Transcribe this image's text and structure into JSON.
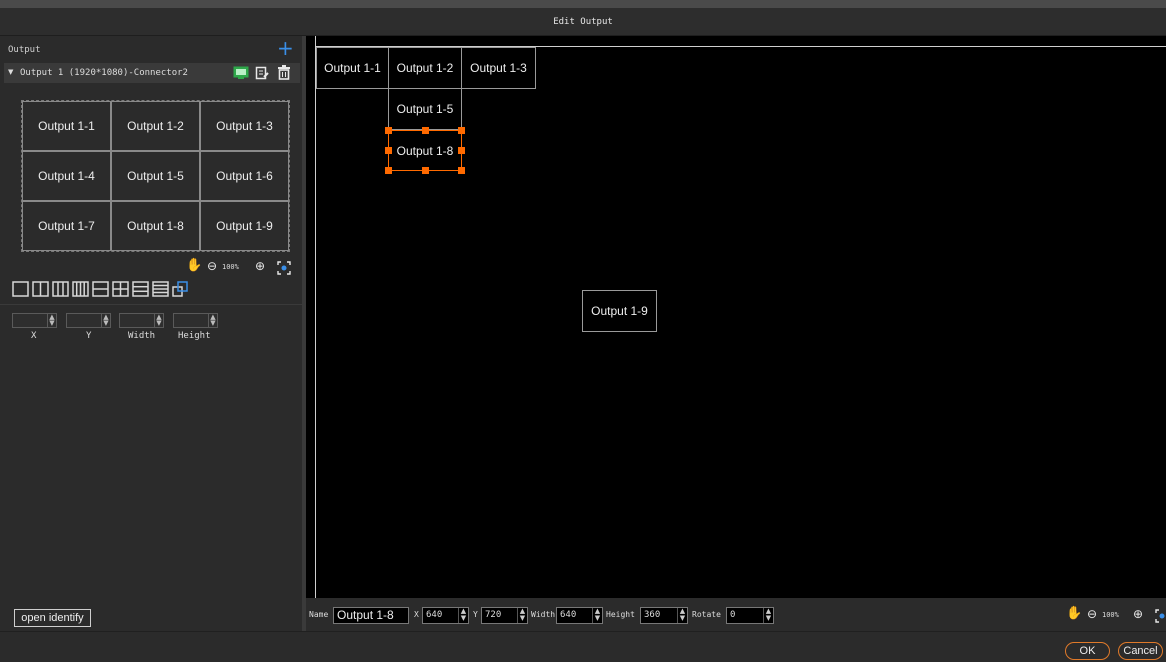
{
  "window": {
    "title": "Edit Output"
  },
  "left_panel": {
    "section_label": "Output",
    "output_row": {
      "label": "Output 1 (1920*1080)-Connector2"
    },
    "preview_cells": [
      "Output 1-1",
      "Output 1-2",
      "Output 1-3",
      "Output 1-4",
      "Output 1-5",
      "Output 1-6",
      "Output 1-7",
      "Output 1-8",
      "Output 1-9"
    ],
    "zoom": "100%",
    "fields": {
      "x_label": "X",
      "y_label": "Y",
      "width_label": "Width",
      "height_label": "Height"
    },
    "open_identify": "open identify"
  },
  "canvas": {
    "cells": {
      "c11": "Output 1-1",
      "c12": "Output 1-2",
      "c13": "Output 1-3",
      "c15": "Output 1-5",
      "c18": "Output 1-8",
      "c19": "Output 1-9"
    },
    "zoom": "100%"
  },
  "props": {
    "name_label": "Name",
    "name_value": "Output 1-8",
    "x_label": "X",
    "x_value": "640",
    "y_label": "Y",
    "y_value": "720",
    "width_label": "Width",
    "width_value": "640",
    "height_label": "Height",
    "height_value": "360",
    "rotate_label": "Rotate",
    "rotate_value": "0"
  },
  "footer": {
    "ok": "OK",
    "cancel": "Cancel"
  },
  "colors": {
    "accent": "#ff6a00",
    "plus": "#3a8fe8",
    "monitor": "#2ea84a"
  },
  "icons": [
    "plus-icon",
    "monitor-icon",
    "edit-icon",
    "trash-icon",
    "hand-icon",
    "zoom-out-icon",
    "zoom-in-icon",
    "fit-icon",
    "layout-icons"
  ]
}
